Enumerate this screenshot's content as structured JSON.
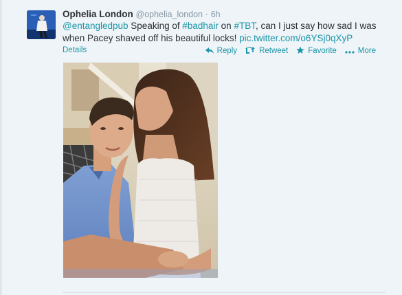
{
  "tweet": {
    "author_name": "Ophelia London",
    "author_handle": "@ophelia_london",
    "separator": "·",
    "timestamp": "6h",
    "text": {
      "mention": "@entangledpub",
      "part1": " Speaking of ",
      "hashtag1": "#badhair",
      "part2": " on ",
      "hashtag2": "#TBT",
      "part3": ", can I just say how sad I was when Pacey shaved off his beautiful locks! ",
      "url": "pic.twitter.com/o6YSj0qXyP"
    },
    "details_label": "Details",
    "actions": {
      "reply": "Reply",
      "retweet": "Retweet",
      "favorite": "Favorite",
      "more": "More"
    },
    "icons": {
      "reply": "reply-icon",
      "retweet": "retweet-icon",
      "favorite": "star-icon",
      "more": "more-dots-icon"
    }
  },
  "colors": {
    "link": "#1b95a8",
    "background": "#eef4f7",
    "muted": "#8899a6"
  }
}
